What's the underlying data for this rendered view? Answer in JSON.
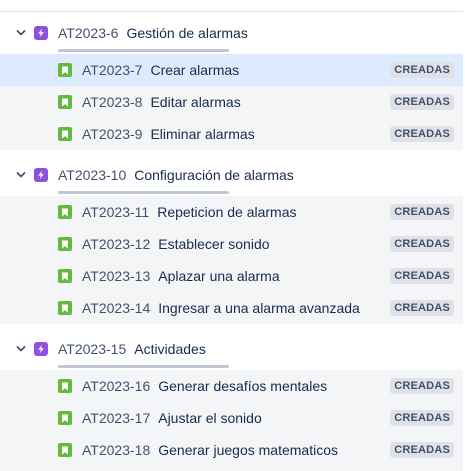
{
  "colors": {
    "epic_icon": "#904ee2",
    "story_icon": "#63ba3c",
    "selected_row": "#deebff",
    "status_badge": "#dfe1e6"
  },
  "epics": [
    {
      "key": "AT2023-6",
      "title": "Gestión de alarmas",
      "expand_icon": "chevron-down-icon",
      "icon": "epic-lightning-icon",
      "progress_done": 0,
      "stories": [
        {
          "key": "AT2023-7",
          "title": "Crear alarmas",
          "status": "CREADAS",
          "icon": "story-bookmark-icon",
          "selected": true
        },
        {
          "key": "AT2023-8",
          "title": "Editar alarmas",
          "status": "CREADAS",
          "icon": "story-bookmark-icon",
          "selected": false
        },
        {
          "key": "AT2023-9",
          "title": "Eliminar alarmas",
          "status": "CREADAS",
          "icon": "story-bookmark-icon",
          "selected": false
        }
      ]
    },
    {
      "key": "AT2023-10",
      "title": "Configuración de alarmas",
      "expand_icon": "chevron-down-icon",
      "icon": "epic-lightning-icon",
      "progress_done": 0,
      "stories": [
        {
          "key": "AT2023-11",
          "title": "Repeticion de alarmas",
          "status": "CREADAS",
          "icon": "story-bookmark-icon",
          "selected": false
        },
        {
          "key": "AT2023-12",
          "title": "Establecer sonido",
          "status": "CREADAS",
          "icon": "story-bookmark-icon",
          "selected": false
        },
        {
          "key": "AT2023-13",
          "title": "Aplazar una alarma",
          "status": "CREADAS",
          "icon": "story-bookmark-icon",
          "selected": false
        },
        {
          "key": "AT2023-14",
          "title": "Ingresar a una alarma avanzada",
          "status": "CREADAS",
          "icon": "story-bookmark-icon",
          "selected": false
        }
      ]
    },
    {
      "key": "AT2023-15",
      "title": "Actividades",
      "expand_icon": "chevron-down-icon",
      "icon": "epic-lightning-icon",
      "progress_done": 0,
      "stories": [
        {
          "key": "AT2023-16",
          "title": "Generar desafíos mentales",
          "status": "CREADAS",
          "icon": "story-bookmark-icon",
          "selected": false
        },
        {
          "key": "AT2023-17",
          "title": "Ajustar el sonido",
          "status": "CREADAS",
          "icon": "story-bookmark-icon",
          "selected": false
        },
        {
          "key": "AT2023-18",
          "title": "Generar juegos matematicos",
          "status": "CREADAS",
          "icon": "story-bookmark-icon",
          "selected": false
        }
      ]
    }
  ]
}
